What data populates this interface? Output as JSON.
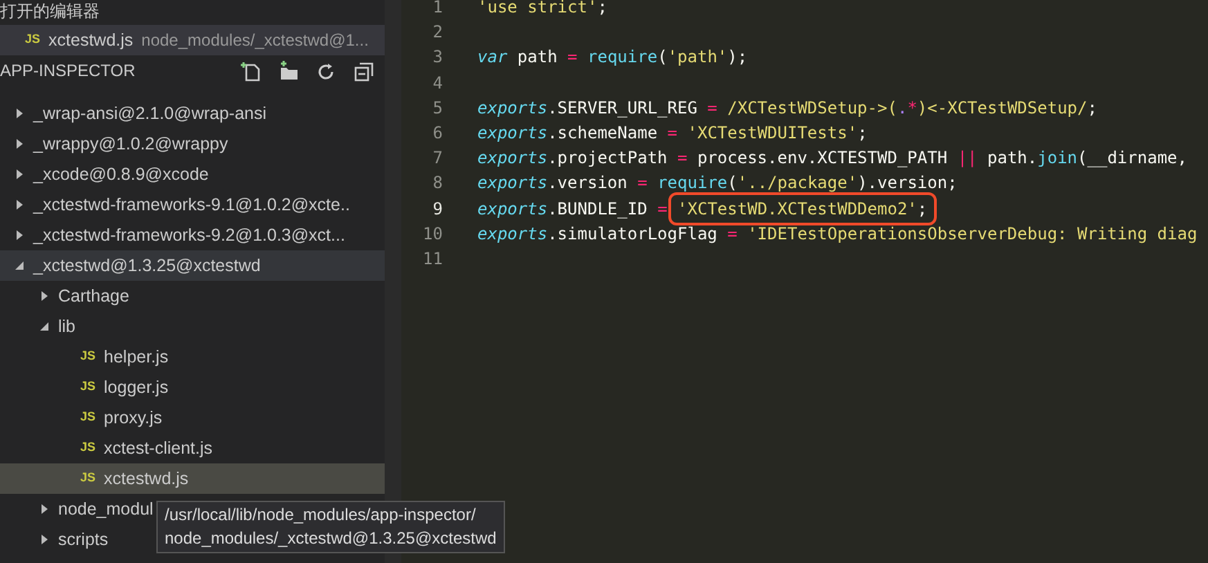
{
  "open_editors": {
    "title": "打开的编辑器",
    "items": [
      {
        "badge": "JS",
        "name": "xctestwd.js",
        "path": "node_modules/_xctestwd@1...",
        "selected": true
      }
    ]
  },
  "explorer": {
    "title": "APP-INSPECTOR",
    "tree": [
      {
        "kind": "folder",
        "label": "_wrap-ansi@2.1.0@wrap-ansi",
        "expanded": false,
        "selected": false
      },
      {
        "kind": "folder",
        "label": "_wrappy@1.0.2@wrappy",
        "expanded": false,
        "selected": false
      },
      {
        "kind": "folder",
        "label": "_xcode@0.8.9@xcode",
        "expanded": false,
        "selected": false
      },
      {
        "kind": "folder",
        "label": "_xctestwd-frameworks-9.1@1.0.2@xcte..",
        "expanded": false,
        "selected": false
      },
      {
        "kind": "folder",
        "label": "_xctestwd-frameworks-9.2@1.0.3@xct...",
        "expanded": false,
        "selected": false
      },
      {
        "kind": "folder",
        "label": "_xctestwd@1.3.25@xctestwd",
        "expanded": true,
        "selected": false,
        "hover": true,
        "children": [
          {
            "kind": "folder",
            "label": "Carthage",
            "expanded": false,
            "selected": false
          },
          {
            "kind": "folder",
            "label": "lib",
            "expanded": true,
            "selected": false,
            "children": [
              {
                "kind": "file",
                "badge": "JS",
                "label": "helper.js",
                "selected": false
              },
              {
                "kind": "file",
                "badge": "JS",
                "label": "logger.js",
                "selected": false
              },
              {
                "kind": "file",
                "badge": "JS",
                "label": "proxy.js",
                "selected": false
              },
              {
                "kind": "file",
                "badge": "JS",
                "label": "xctest-client.js",
                "selected": false
              },
              {
                "kind": "file",
                "badge": "JS",
                "label": "xctestwd.js",
                "selected": true
              }
            ]
          },
          {
            "kind": "folder",
            "label": "node_modul",
            "expanded": false,
            "selected": false
          },
          {
            "kind": "folder",
            "label": "scripts",
            "expanded": false,
            "selected": false
          }
        ]
      }
    ]
  },
  "tooltip": {
    "lines": [
      "/usr/local/lib/node_modules/app-inspector/",
      "node_modules/_xctestwd@1.3.25@xctestwd"
    ]
  },
  "editor": {
    "lines": [
      {
        "number": "1",
        "current": false,
        "tokens": [
          {
            "kind": "str",
            "text": "'use strict'"
          },
          {
            "kind": "plain",
            "text": ";"
          }
        ]
      },
      {
        "number": "2",
        "current": false
      },
      {
        "number": "3",
        "current": false,
        "tokens": [
          {
            "kind": "kw",
            "text": "var"
          },
          {
            "kind": "plain",
            "text": " path "
          },
          {
            "kind": "op",
            "text": "="
          },
          {
            "kind": "fn",
            "text": " require"
          },
          {
            "kind": "plain",
            "text": "("
          },
          {
            "kind": "str",
            "text": "'path'"
          },
          {
            "kind": "plain",
            "text": ");"
          }
        ]
      },
      {
        "number": "4",
        "current": false
      },
      {
        "number": "5",
        "current": false,
        "tokens": [
          {
            "kind": "kw",
            "text": "exports"
          },
          {
            "kind": "plain",
            "text": ".SERVER_URL_REG "
          },
          {
            "kind": "op",
            "text": "="
          },
          {
            "kind": "str",
            "text": " /XCTestWDSetup->("
          },
          {
            "kind": "const",
            "text": "."
          },
          {
            "kind": "op",
            "text": "*"
          },
          {
            "kind": "str",
            "text": ")<-XCTestWDSetup/"
          },
          {
            "kind": "plain",
            "text": ";"
          }
        ]
      },
      {
        "number": "6",
        "current": false,
        "tokens": [
          {
            "kind": "kw",
            "text": "exports"
          },
          {
            "kind": "plain",
            "text": ".schemeName "
          },
          {
            "kind": "op",
            "text": "="
          },
          {
            "kind": "str",
            "text": " 'XCTestWDUITests'"
          },
          {
            "kind": "plain",
            "text": ";"
          }
        ]
      },
      {
        "number": "7",
        "current": false,
        "tokens": [
          {
            "kind": "kw",
            "text": "exports"
          },
          {
            "kind": "plain",
            "text": ".projectPath "
          },
          {
            "kind": "op",
            "text": "="
          },
          {
            "kind": "plain",
            "text": " process.env.XCTESTWD_PATH "
          },
          {
            "kind": "op",
            "text": "||"
          },
          {
            "kind": "plain",
            "text": " path."
          },
          {
            "kind": "fn",
            "text": "join"
          },
          {
            "kind": "plain",
            "text": "(__dirname,"
          }
        ]
      },
      {
        "number": "8",
        "current": false,
        "tokens": [
          {
            "kind": "kw",
            "text": "exports"
          },
          {
            "kind": "plain",
            "text": ".version "
          },
          {
            "kind": "op",
            "text": "="
          },
          {
            "kind": "fn",
            "text": " require"
          },
          {
            "kind": "plain",
            "text": "("
          },
          {
            "kind": "str",
            "text": "'../package'"
          },
          {
            "kind": "plain",
            "text": ").version;"
          }
        ]
      },
      {
        "number": "9",
        "current": true,
        "tokens": [
          {
            "kind": "kw",
            "text": "exports"
          },
          {
            "kind": "plain",
            "text": ".BUNDLE_ID "
          },
          {
            "kind": "op",
            "text": "= "
          },
          {
            "kind": "str",
            "text": "'XCTestWD.XCTestWDDemo2'",
            "boxed": true
          },
          {
            "kind": "plain",
            "text": ";",
            "boxed": true
          }
        ]
      },
      {
        "number": "10",
        "current": false,
        "tokens": [
          {
            "kind": "kw",
            "text": "exports"
          },
          {
            "kind": "plain",
            "text": ".simulatorLogFlag "
          },
          {
            "kind": "op",
            "text": "="
          },
          {
            "kind": "str",
            "text": " 'IDETestOperationsObserverDebug: Writing diag"
          }
        ]
      },
      {
        "number": "11",
        "current": false
      }
    ]
  }
}
